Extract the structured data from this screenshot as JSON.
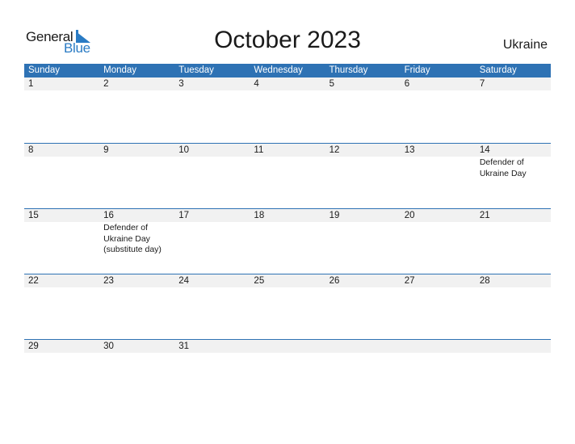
{
  "logo": {
    "general": "General",
    "blue": "Blue",
    "accent_color": "#2a7bc4"
  },
  "header": {
    "title": "October 2023",
    "country": "Ukraine"
  },
  "colors": {
    "header_bg": "#2e72b4",
    "band_bg": "#f1f1f1"
  },
  "weekdays": [
    "Sunday",
    "Monday",
    "Tuesday",
    "Wednesday",
    "Thursday",
    "Friday",
    "Saturday"
  ],
  "weeks": [
    [
      {
        "day": "1"
      },
      {
        "day": "2"
      },
      {
        "day": "3"
      },
      {
        "day": "4"
      },
      {
        "day": "5"
      },
      {
        "day": "6"
      },
      {
        "day": "7"
      }
    ],
    [
      {
        "day": "8"
      },
      {
        "day": "9"
      },
      {
        "day": "10"
      },
      {
        "day": "11"
      },
      {
        "day": "12"
      },
      {
        "day": "13"
      },
      {
        "day": "14",
        "event": "Defender of Ukraine Day"
      }
    ],
    [
      {
        "day": "15"
      },
      {
        "day": "16",
        "event": "Defender of Ukraine Day (substitute day)"
      },
      {
        "day": "17"
      },
      {
        "day": "18"
      },
      {
        "day": "19"
      },
      {
        "day": "20"
      },
      {
        "day": "21"
      }
    ],
    [
      {
        "day": "22"
      },
      {
        "day": "23"
      },
      {
        "day": "24"
      },
      {
        "day": "25"
      },
      {
        "day": "26"
      },
      {
        "day": "27"
      },
      {
        "day": "28"
      }
    ],
    [
      {
        "day": "29"
      },
      {
        "day": "30"
      },
      {
        "day": "31"
      },
      {
        "day": ""
      },
      {
        "day": ""
      },
      {
        "day": ""
      },
      {
        "day": ""
      }
    ]
  ]
}
